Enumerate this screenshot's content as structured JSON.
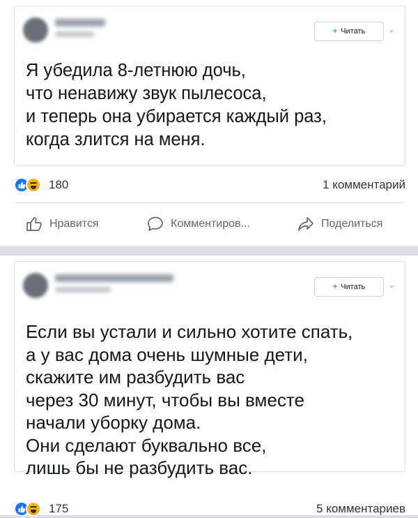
{
  "posts": [
    {
      "follow_label": "Читать",
      "text_lines": [
        "Я убедила 8-летнюю дочь,",
        "что ненавижу звук пылесоса,",
        "и теперь она убирается каждый раз,",
        "когда злится на меня."
      ],
      "reaction_count": "180",
      "comments_label": "1 комментарий"
    },
    {
      "follow_label": "Читать",
      "text_lines": [
        "Если вы устали и сильно хотите спать,",
        "а у вас дома очень шумные дети,",
        "скажите им разбудить вас",
        "через 30 минут, чтобы вы вместе",
        "начали уборку дома.",
        "Они сделают буквально все,",
        "лишь бы не разбудить вас."
      ],
      "reaction_count": "175",
      "comments_label": "5 комментариев"
    }
  ],
  "actions": {
    "like_label": "Нравится",
    "comment_label": "Комментиров...",
    "share_label": "Поделиться"
  },
  "colors": {
    "like_blue": "#1877f2",
    "haha_yellow": "#f7b125",
    "follow_icon": "#1da1f2",
    "separator_gray": "#dcdee3"
  }
}
